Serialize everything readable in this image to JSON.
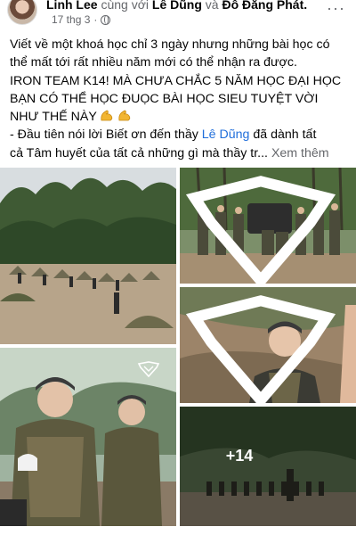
{
  "post": {
    "author": "Linh Lee",
    "with_word": "cùng với",
    "tag1": "Lê Dũng",
    "and_word": "và",
    "tag2": "Đỗ Đăng Phát",
    "date": "17 thg 3",
    "dot": "·",
    "more": "···",
    "lines": [
      "Viết về một khoá học chỉ 3 ngày nhưng những bài học có",
      "thể mất tới rất nhiều năm mới có thể nhận ra được.",
      "IRON TEAM K14! MÀ CHƯA CHẮC 5 NĂM HỌC ĐẠI HỌC",
      "BẠN CÓ THỂ HỌC ĐUỌC BÀI HỌC SIEU TUYỆT VỜI",
      "NHƯ THẾ NÀY"
    ],
    "thanks_prefix": "- Đầu tiên nói lời Biết ơn đến thầy",
    "thanks_link": "Lê Dũng",
    "thanks_suffix": "đã dành tất",
    "last_line": "cả Tâm huyết của tất cả những gì mà thầy tr...",
    "see_more": "Xem thêm"
  },
  "photos": {
    "extra_count": "+14"
  },
  "colors": {
    "link": "#216fdb",
    "muted": "#65676b",
    "text": "#050505"
  },
  "icons": [
    "globe-icon",
    "more-options-icon",
    "flexed-biceps-icon",
    "iron-team-logo-icon"
  ]
}
